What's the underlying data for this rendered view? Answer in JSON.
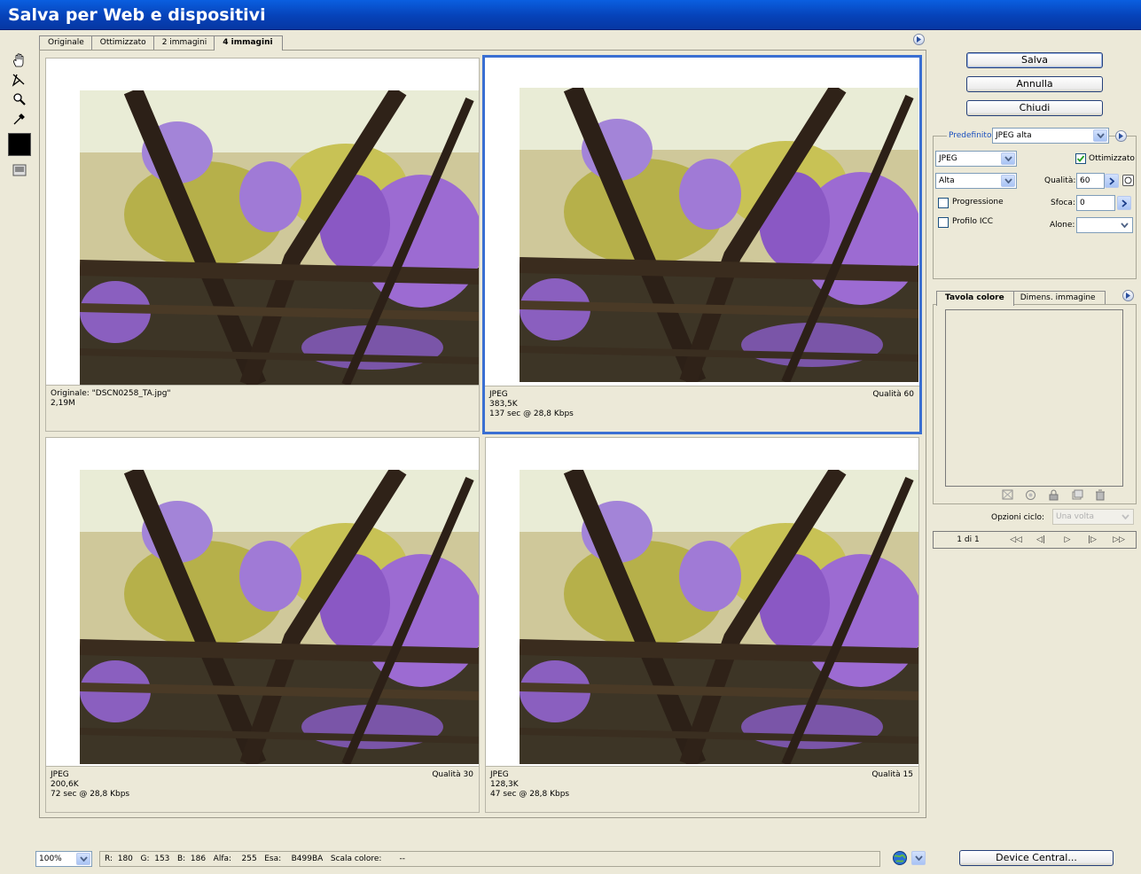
{
  "window": {
    "title": "Salva per Web e dispositivi"
  },
  "tabs": [
    {
      "label": "Originale"
    },
    {
      "label": "Ottimizzato"
    },
    {
      "label": "2 immagini"
    },
    {
      "label": "4 immagini",
      "active": true
    }
  ],
  "tools": [
    "hand-tool-icon",
    "slice-select-tool-icon",
    "zoom-tool-icon",
    "eyedropper-tool-icon",
    "eyedropper-color-swatch",
    "toggle-slices-icon"
  ],
  "panes": [
    {
      "line1": "Originale: \"DSCN0258_TA.jpg\"",
      "line2": "2,19M",
      "line3": "",
      "quality": ""
    },
    {
      "line1": "JPEG",
      "line2": "383,5K",
      "line3": "137 sec @ 28,8 Kbps",
      "quality": "Qualità 60"
    },
    {
      "line1": "JPEG",
      "line2": "200,6K",
      "line3": "72 sec @ 28,8 Kbps",
      "quality": "Qualità 30"
    },
    {
      "line1": "JPEG",
      "line2": "128,3K",
      "line3": "47 sec @ 28,8 Kbps",
      "quality": "Qualità 15"
    }
  ],
  "buttons": {
    "save": "Salva",
    "cancel": "Annulla",
    "close": "Chiudi",
    "device_central": "Device Central..."
  },
  "settings": {
    "preset_label": "Predefinito:",
    "preset_value": "JPEG alta",
    "format_value": "JPEG",
    "optimized_label": "Ottimizzato",
    "optimized_checked": true,
    "quality_level_value": "Alta",
    "quality_label": "Qualità:",
    "quality_value": "60",
    "progressive_label": "Progressione",
    "blur_label": "Sfoca:",
    "blur_value": "0",
    "icc_label": "Profilo ICC",
    "matte_label": "Alone:",
    "matte_value": ""
  },
  "color_table": {
    "tab_colors": "Tavola colore",
    "tab_size": "Dimens. immagine"
  },
  "animation": {
    "loop_label": "Opzioni ciclo:",
    "loop_value": "Una volta",
    "frame_counter": "1 di 1"
  },
  "status": {
    "zoom": "100%",
    "readout": "R:  180   G:  153   B:  186   Alfa:    255   Esa:    B499BA   Scala colore:       --"
  },
  "colors": {
    "title_bar": "#0a5fe0",
    "selection_border": "#3a6fd2",
    "panel_bg": "#ece9d8"
  }
}
